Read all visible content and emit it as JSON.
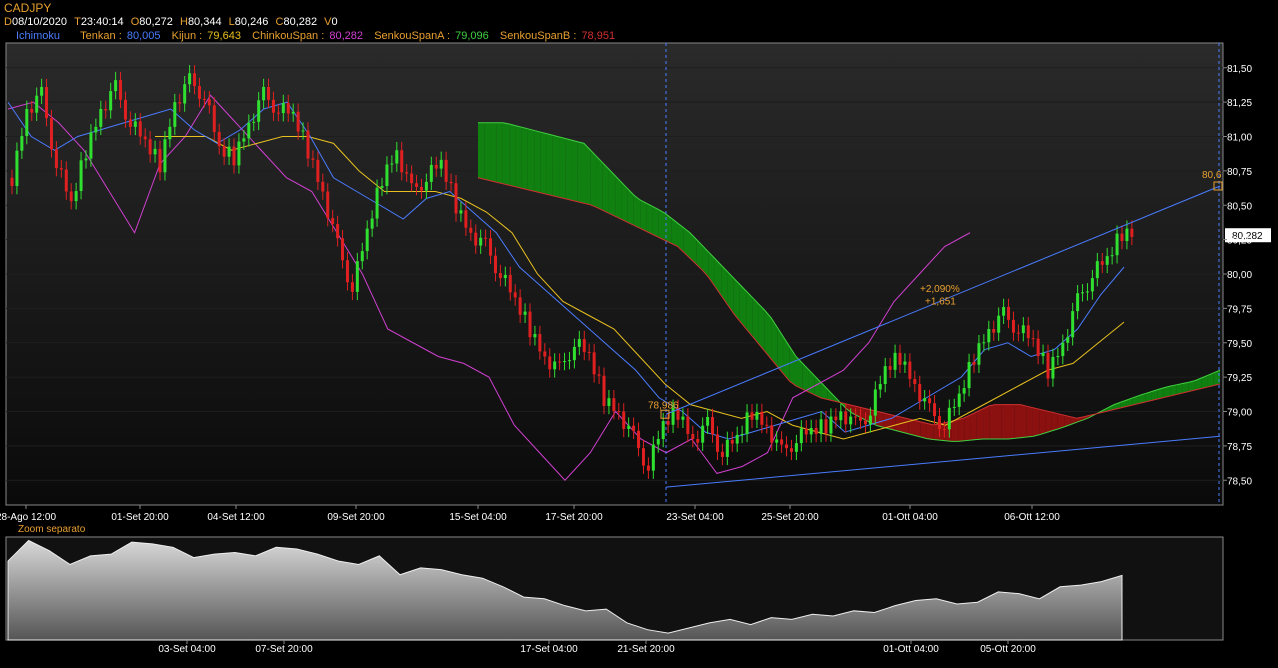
{
  "header": {
    "symbol": "CADJPY",
    "d_key": "D",
    "d_val": "08/10/2020",
    "t_key": "T",
    "t_val": "23:40:14",
    "o_key": "O",
    "o_val": "80,272",
    "h_key": "H",
    "h_val": "80,344",
    "l_key": "L",
    "l_val": "80,246",
    "c_key": "C",
    "c_val": "80,282",
    "v_key": "V",
    "v_val": "0"
  },
  "indicators": {
    "name": "Ichimoku",
    "tenkan_label": "Tenkan :",
    "tenkan_val": "80,005",
    "kijun_label": "Kijun :",
    "kijun_val": "79,643",
    "chikou_label": "ChinkouSpan :",
    "chikou_val": "80,282",
    "senkouA_label": "SenkouSpanA :",
    "senkouA_val": "79,096",
    "senkouB_label": "SenkouSpanB :",
    "senkouB_val": "78,951"
  },
  "colors": {
    "tenkan": "#4a7cff",
    "kijun": "#e8c020",
    "chikou": "#d040d0",
    "senkouA": "#40d040",
    "senkouB": "#d03030",
    "up": "#30e030",
    "down": "#e02020",
    "cloud_bear": "#8b1010",
    "cloud_bull": "#108010",
    "label_orange": "#e8a030",
    "trendline": "#4a7cff"
  },
  "zoom_label": "Zoom separato",
  "annotations": {
    "price_marker_left": "78,986",
    "price_marker_right": "80,6",
    "pct_change": "+2,090%",
    "abs_change": "+1,651",
    "last_price": "80,282"
  },
  "chart_data": [
    {
      "type": "candlestick",
      "title": "CADJPY",
      "y_ticks": [
        "81,50",
        "81,25",
        "81,00",
        "80,75",
        "80,50",
        "80,25",
        "80,00",
        "79,75",
        "79,50",
        "79,25",
        "79,00",
        "78,75",
        "78,50"
      ],
      "ylim": [
        78.32,
        81.68
      ],
      "x_ticks": [
        "28-Ago 12:00",
        "01-Set 20:00",
        "04-Set 12:00",
        "09-Set 20:00",
        "15-Set 04:00",
        "17-Set 20:00",
        "23-Set 04:00",
        "25-Set 20:00",
        "01-Ott 04:00",
        "06-Ott 12:00"
      ],
      "price": [
        80.7,
        81.2,
        81.3,
        80.8,
        80.5,
        80.9,
        81.2,
        81.35,
        81.1,
        80.95,
        80.8,
        81.25,
        81.4,
        81.3,
        80.9,
        80.85,
        81.1,
        81.3,
        81.2,
        81.15,
        80.9,
        80.6,
        80.2,
        79.9,
        80.3,
        80.7,
        80.9,
        80.6,
        80.7,
        80.8,
        80.5,
        80.3,
        80.2,
        80.0,
        79.8,
        79.6,
        79.4,
        79.3,
        79.5,
        79.4,
        79.1,
        79.0,
        78.8,
        78.6,
        78.9,
        79.0,
        78.8,
        78.9,
        78.7,
        78.8,
        79.0,
        78.9,
        78.7,
        78.8,
        78.85,
        78.9,
        79.0,
        78.9,
        79.0,
        79.3,
        79.4,
        79.2,
        79.0,
        78.9,
        79.1,
        79.4,
        79.6,
        79.7,
        79.6,
        79.5,
        79.3,
        79.5,
        79.8,
        80.0,
        80.1,
        80.3
      ],
      "tenkan": [
        81.25,
        81.0,
        80.9,
        81.0,
        81.05,
        81.1,
        81.15,
        81.2,
        81.05,
        80.95,
        81.05,
        81.2,
        81.25,
        81.0,
        80.7,
        80.6,
        80.5,
        80.4,
        80.55,
        80.6,
        80.45,
        80.3,
        80.05,
        79.9,
        79.75,
        79.6,
        79.45,
        79.3,
        79.1,
        79.0,
        78.85,
        78.8,
        78.85,
        78.9,
        78.95,
        79.0,
        78.85,
        78.9,
        78.95,
        79.05,
        79.15,
        79.25,
        79.45,
        79.5,
        79.4,
        79.45,
        79.6,
        79.85,
        80.05
      ],
      "kijun": [
        81.0,
        81.0,
        81.0,
        80.9,
        80.95,
        81.0,
        81.0,
        80.95,
        80.75,
        80.6,
        80.6,
        80.6,
        80.55,
        80.45,
        80.3,
        80.0,
        79.8,
        79.7,
        79.6,
        79.4,
        79.2,
        79.05,
        79.0,
        78.95,
        79.0,
        78.9,
        78.85,
        78.8,
        78.85,
        78.9,
        78.95,
        78.9,
        79.0,
        79.1,
        79.2,
        79.3,
        79.35,
        79.5,
        79.65
      ],
      "chikou": [
        81.2,
        81.25,
        81.1,
        80.9,
        80.6,
        80.3,
        80.8,
        81.0,
        81.3,
        81.1,
        80.9,
        80.7,
        80.6,
        80.3,
        80.0,
        79.6,
        79.5,
        79.4,
        79.35,
        79.25,
        78.9,
        78.7,
        78.5,
        78.7,
        79.0,
        78.8,
        78.7,
        78.8,
        78.55,
        78.6,
        78.7,
        79.1,
        79.2,
        79.3,
        79.5,
        79.8,
        80.0,
        80.2,
        80.3
      ],
      "senkouA": [
        81.1,
        81.1,
        81.05,
        81.0,
        80.95,
        80.75,
        80.55,
        80.45,
        80.3,
        80.1,
        79.9,
        79.7,
        79.4,
        79.2,
        79.0,
        78.9,
        78.85,
        78.8,
        78.78,
        78.8,
        78.8,
        78.82,
        78.88,
        78.95,
        79.05,
        79.12,
        79.18,
        79.22,
        79.3
      ],
      "senkouB": [
        80.7,
        80.65,
        80.6,
        80.55,
        80.5,
        80.4,
        80.3,
        80.2,
        80.0,
        79.7,
        79.45,
        79.2,
        79.1,
        79.05,
        79.0,
        78.95,
        78.9,
        78.95,
        79.05,
        79.05,
        79.0,
        78.95,
        79.0,
        79.05,
        79.1,
        79.15,
        79.2
      ]
    },
    {
      "type": "area",
      "title": "Zoom separato",
      "x_ticks": [
        "03-Set 04:00",
        "07-Set 20:00",
        "17-Set 04:00",
        "21-Set 20:00",
        "01-Ott 04:00",
        "05-Ott 20:00"
      ],
      "values": [
        80.7,
        81.3,
        81.0,
        80.6,
        80.85,
        80.9,
        81.25,
        81.2,
        81.1,
        80.8,
        80.9,
        80.95,
        80.85,
        81.1,
        81.05,
        80.9,
        80.7,
        80.6,
        80.85,
        80.3,
        80.5,
        80.45,
        80.3,
        80.2,
        79.95,
        79.65,
        79.6,
        79.4,
        79.25,
        79.3,
        78.9,
        78.7,
        78.6,
        78.75,
        78.9,
        79.0,
        78.85,
        79.05,
        79.0,
        79.15,
        79.1,
        79.25,
        79.2,
        79.4,
        79.55,
        79.6,
        79.45,
        79.5,
        79.8,
        79.75,
        79.6,
        79.95,
        80.0,
        80.1,
        80.28
      ]
    }
  ]
}
